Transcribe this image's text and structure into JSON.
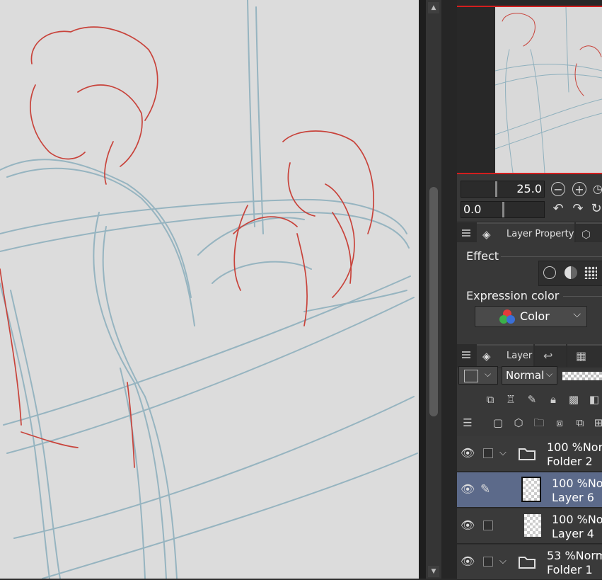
{
  "navigator": {
    "zoom": "25.0",
    "rotation": "0.0"
  },
  "tabs": {
    "layer_property": "Layer Property",
    "layer": "Layer"
  },
  "layer_property": {
    "effect_label": "Effect",
    "expression_color_label": "Expression color",
    "expression_color_value": "Color"
  },
  "layer_panel": {
    "blend_mode": "Normal"
  },
  "layers": [
    {
      "name": "Folder 2",
      "opacity": "100 %",
      "mode": "Norm",
      "type": "folder",
      "selected": false
    },
    {
      "name": "Layer 6",
      "opacity": "100 %",
      "mode": "No",
      "type": "raster",
      "selected": true
    },
    {
      "name": "Layer 4",
      "opacity": "100 %",
      "mode": "No",
      "type": "raster",
      "selected": false
    },
    {
      "name": "Folder 1",
      "opacity": "53 %",
      "mode": "Norm",
      "type": "folder",
      "selected": false
    }
  ],
  "colors": {
    "sketch_red": "#c8433b",
    "sketch_blue": "#8fb0bd",
    "selected_row": "#5c6a8a"
  }
}
